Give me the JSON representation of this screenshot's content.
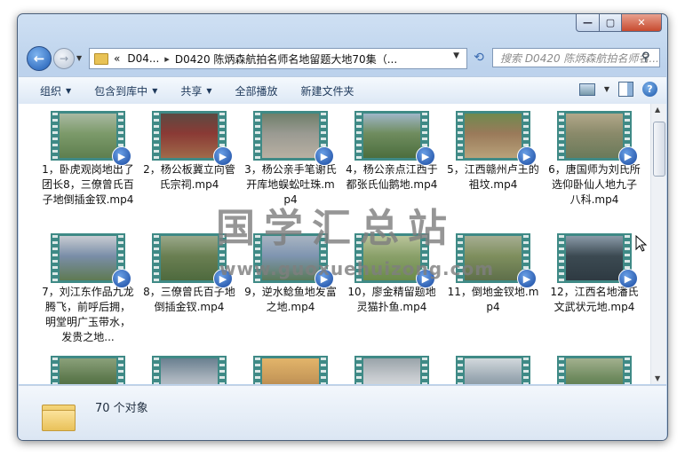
{
  "window": {
    "controls": {
      "minimize_icon": "minimize-icon",
      "maximize_icon": "maximize-icon",
      "close_icon": "close-icon"
    }
  },
  "nav": {
    "address": {
      "chevron": "«",
      "seg1": "D04...",
      "sep": "▸",
      "seg2": "D0420 陈炳森航拍名师名地留题大地70集（..."
    },
    "search_placeholder": "搜索 D0420 陈炳森航拍名师名..."
  },
  "toolbar": {
    "organize": "组织",
    "include_library": "包含到库中",
    "share": "共享",
    "play_all": "全部播放",
    "new_folder": "新建文件夹"
  },
  "items": [
    {
      "label": "1，卧虎观岗地出了团长8，三僚曾氏百子地倒插金钗.mp4"
    },
    {
      "label": "2，杨公板冀立向管氏宗祠.mp4"
    },
    {
      "label": "3，杨公亲手笔谢氏开库地蜈蚣吐珠.mp4"
    },
    {
      "label": "4，杨公亲点江西于都张氏仙鹅地.mp4"
    },
    {
      "label": "5，江西赣州卢王的祖坟.mp4"
    },
    {
      "label": "6，唐国师为刘氏所选仰卧仙人地九子八科.mp4"
    },
    {
      "label": "7，刘江东作品九龙腾飞，前呼后拥，明堂明广玉带水，发贵之地..."
    },
    {
      "label": "8，三僚曾氏百子地倒插金钗.mp4"
    },
    {
      "label": "9，逆水鲶鱼地发富之地.mp4"
    },
    {
      "label": "10，廖金精留题地灵猫扑鱼.mp4"
    },
    {
      "label": "11，倒地金钗地.mp4"
    },
    {
      "label": "12，江西名地潘氏文武状元地.mp4"
    },
    {
      "label": ""
    },
    {
      "label": ""
    },
    {
      "label": ""
    },
    {
      "label": ""
    },
    {
      "label": ""
    },
    {
      "label": ""
    }
  ],
  "watermark": {
    "text": "国学汇总站",
    "url": "www.guoxuehuizong.com"
  },
  "details": {
    "count": "70 个对象"
  },
  "colors": {
    "film": "#3f8a86",
    "accent": "#1e5bb3"
  }
}
